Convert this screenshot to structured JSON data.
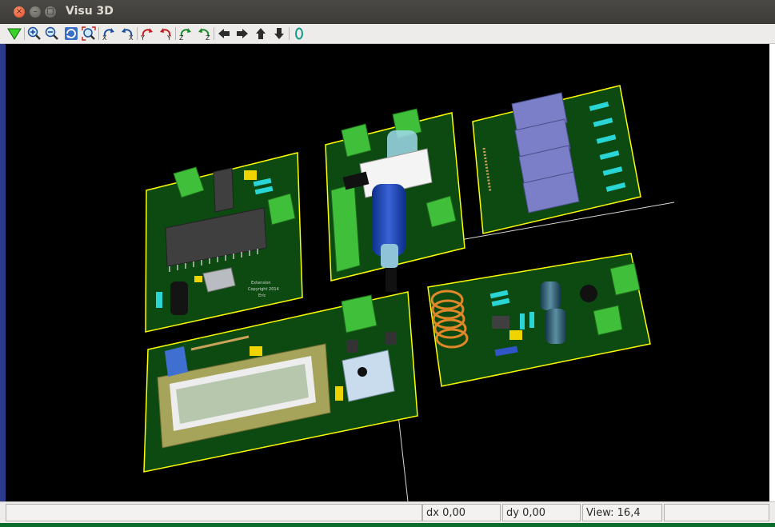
{
  "window": {
    "title": "Visu 3D",
    "controls": [
      "close",
      "minimize",
      "maximize"
    ]
  },
  "toolbar": {
    "buttons": [
      "redraw-icon",
      "zoom-in-icon",
      "zoom-out-icon",
      "refresh-icon",
      "zoom-fit-icon",
      "rotate-x-neg-icon",
      "rotate-x-pos-icon",
      "rotate-y-neg-icon",
      "rotate-y-pos-icon",
      "rotate-z-neg-icon",
      "rotate-z-pos-icon",
      "pan-left-icon",
      "pan-right-icon",
      "pan-up-icon",
      "pan-down-icon",
      "ortho-icon"
    ]
  },
  "viewport": {
    "background": "#000000",
    "board_color": "#0d4a12",
    "outline_color": "#ffff00",
    "silkscreen_text": [
      "Extension",
      "Copyright 2014",
      "Eric"
    ]
  },
  "status": {
    "message": "",
    "dx": "dx 0,00",
    "dy": "dy 0,00",
    "view": "View: 16,4",
    "extra": ""
  }
}
